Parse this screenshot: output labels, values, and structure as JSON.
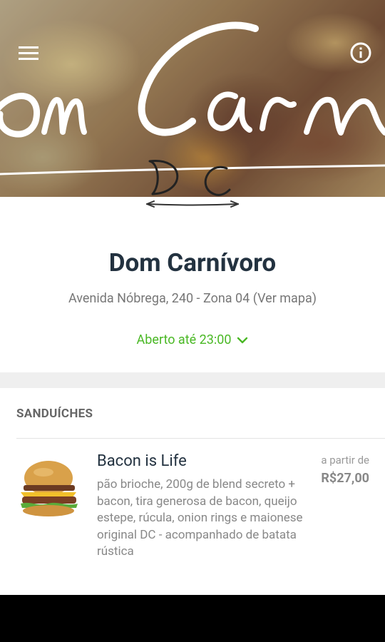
{
  "hero": {
    "logo_text": "Dom Carnívoro",
    "logo_monogram": "DC",
    "menu_icon": "hamburger-menu-icon",
    "info_icon": "info-circle-icon"
  },
  "restaurant": {
    "name": "Dom Carnívoro",
    "address": "Avenida Nóbrega, 240 - Zona 04 (Ver mapa)",
    "hours": "Aberto até 23:00",
    "hours_icon": "chevron-down-icon"
  },
  "menu": {
    "section_title": "SANDUÍCHES",
    "items": [
      {
        "name": "Bacon is Life",
        "description": "pão brioche, 200g de blend secreto + bacon, tira generosa de bacon, queijo estepe, rúcula, onion rings e maionese original DC - acompanhado de batata rústica",
        "price_label": "a partir de",
        "price": "R$27,00",
        "image_icon": "burger-image"
      }
    ]
  },
  "colors": {
    "title": "#233240",
    "open_status": "#4ab825",
    "muted": "#777777"
  }
}
